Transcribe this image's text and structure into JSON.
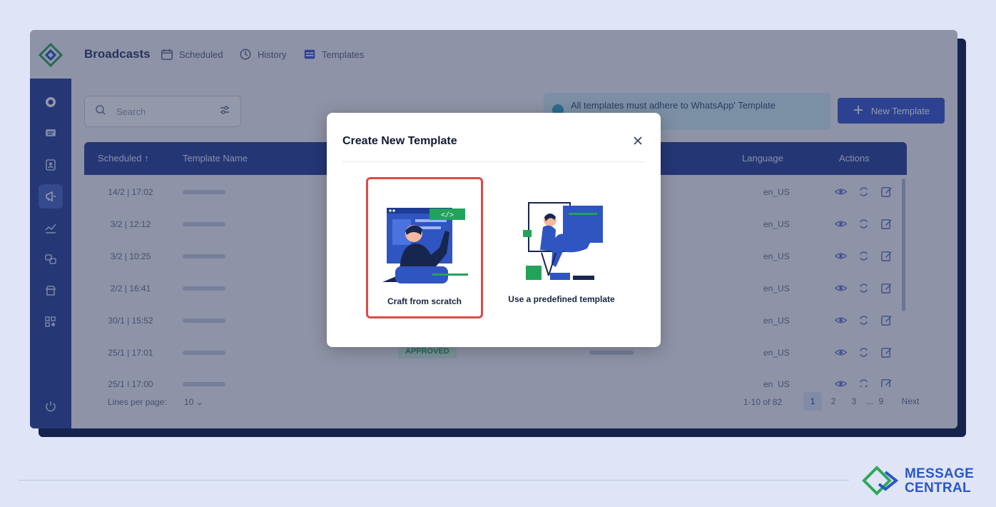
{
  "header": {
    "title": "Broadcasts",
    "tabs": [
      {
        "label": "Scheduled",
        "icon": "calendar-icon"
      },
      {
        "label": "History",
        "icon": "history-icon"
      },
      {
        "label": "Templates",
        "icon": "template-icon"
      }
    ]
  },
  "sidebar": {
    "items": [
      {
        "name": "whatsapp",
        "icon": "whatsapp-icon"
      },
      {
        "name": "messages",
        "icon": "chat-icon"
      },
      {
        "name": "contacts",
        "icon": "contacts-icon"
      },
      {
        "name": "broadcasts",
        "icon": "megaphone-icon",
        "active": true
      },
      {
        "name": "analytics",
        "icon": "analytics-icon"
      },
      {
        "name": "automation",
        "icon": "automation-icon"
      },
      {
        "name": "catalog",
        "icon": "store-icon"
      },
      {
        "name": "settings",
        "icon": "apps-settings-icon"
      }
    ],
    "bottom_icon": "power-icon"
  },
  "search": {
    "placeholder": "Search",
    "filter_icon": "filter-icon"
  },
  "notice": {
    "text": "All templates must adhere to WhatsApp' Template"
  },
  "new_template_label": "New Template",
  "table": {
    "columns": {
      "scheduled": "Scheduled",
      "name": "Template Name",
      "language": "Language",
      "actions": "Actions"
    },
    "rows": [
      {
        "scheduled": "14/2 | 17:02",
        "language": "en_US"
      },
      {
        "scheduled": "3/2 | 12:12",
        "language": "en_US"
      },
      {
        "scheduled": "3/2 | 10:25",
        "language": "en_US"
      },
      {
        "scheduled": "2/2 | 16:41",
        "language": "en_US"
      },
      {
        "scheduled": "30/1 | 15:52",
        "language": "en_US"
      },
      {
        "scheduled": "25/1 | 17:01",
        "language": "en_US",
        "status": "APPROVED"
      },
      {
        "scheduled": "25/1 | 17:00",
        "language": "en_US"
      }
    ]
  },
  "pagination": {
    "lines_per_page_label": "Lines per page:",
    "lines_per_page": "10",
    "range": "1-10 of 82",
    "pages": [
      "1",
      "2",
      "3",
      "...",
      "9"
    ],
    "current_page": "1",
    "next_label": "Next"
  },
  "modal": {
    "title": "Create New Template",
    "options": [
      {
        "label": "Craft from scratch",
        "selected": true
      },
      {
        "label": "Use a predefined template",
        "selected": false
      }
    ]
  },
  "brand": {
    "line1": "MESSAGE",
    "line2": "CENTRAL"
  },
  "colors": {
    "primary": "#2c4699",
    "accent": "#3a5bd0",
    "highlight": "#e24848",
    "brand_green": "#2fa85a",
    "brand_blue": "#2a56c8"
  }
}
